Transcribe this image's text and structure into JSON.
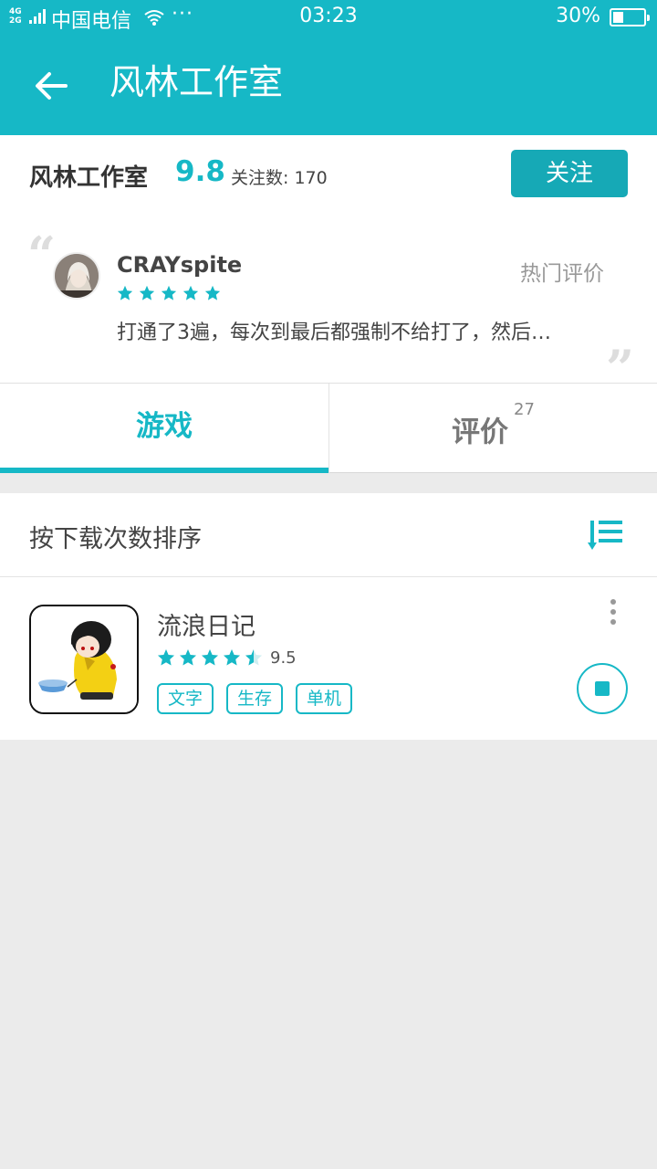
{
  "status_bar": {
    "network": "4G\n2G",
    "carrier": "中国电信",
    "more": "···",
    "time": "03:23",
    "battery_percent": "30%",
    "battery_level": 0.3
  },
  "header": {
    "title": "风林工作室"
  },
  "studio": {
    "name": "风林工作室",
    "score": "9.8",
    "followers": "关注数: 170",
    "follow_label": "关注"
  },
  "hot_review": {
    "label": "热门评价",
    "reviewer": "CRAYspite",
    "rating_stars": 5,
    "text": "打通了3遍，每次到最后都强制不给打了，然后…",
    "quote_open": "“",
    "quote_close": "”"
  },
  "tabs": [
    {
      "label": "游戏",
      "badge": ""
    },
    {
      "label": "评价",
      "badge": "27"
    }
  ],
  "sort": {
    "label": "按下载次数排序"
  },
  "games": [
    {
      "name": "流浪日记",
      "rating_stars": 4.5,
      "score": "9.5",
      "tags": [
        "文字",
        "生存",
        "单机"
      ]
    }
  ],
  "colors": {
    "accent": "#16b8c6",
    "button": "#16a9b6",
    "background": "#ebebeb"
  }
}
